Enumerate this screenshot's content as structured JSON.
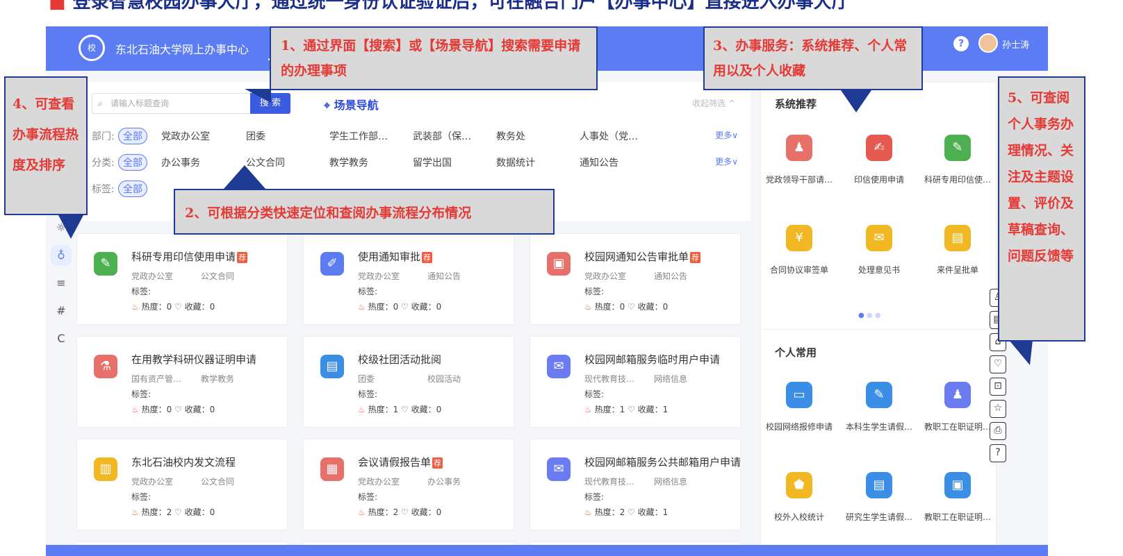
{
  "slide": {
    "title": "登录智慧校园办事大厅，通过统一身份认证验证后，可在融合门户【办事中心】直接进入办事大厅"
  },
  "header": {
    "site_name": "东北石油大学网上办事中心",
    "help": "?",
    "user": "孙士涛"
  },
  "search": {
    "placeholder": "请输入标题查询",
    "button": "搜 索",
    "scene_nav": "场景导航",
    "collapse": "收起筛选 ^"
  },
  "filters": [
    {
      "label": "部门:",
      "all": "全部",
      "items": [
        "党政办公室",
        "团委",
        "学生工作部…",
        "武装部（保…",
        "教务处",
        "人事处（党…"
      ],
      "more": "更多∨"
    },
    {
      "label": "分类:",
      "all": "全部",
      "items": [
        "办公事务",
        "公文合同",
        "教学教务",
        "留学出国",
        "数据统计",
        "通知公告"
      ],
      "more": "更多∨"
    },
    {
      "label": "标签:",
      "all": "全部",
      "items": [],
      "more": ""
    }
  ],
  "cards": [
    {
      "name": "科研专用印信使用申请",
      "badge": "荐",
      "dept": "党政办公室",
      "cat": "公文合同",
      "tag": "标签:",
      "stats": "热度：0 ♡ 收藏：0",
      "color": "#4caf50"
    },
    {
      "name": "使用通知审批",
      "badge": "荐",
      "dept": "党政办公室",
      "cat": "通知公告",
      "tag": "标签:",
      "stats": "热度：0 ♡ 收藏：0",
      "color": "#5b7cf2"
    },
    {
      "name": "校园网通知公告审批单",
      "badge": "荐",
      "dept": "党政办公室",
      "cat": "通知公告",
      "tag": "标签:",
      "stats": "热度：0 ♡ 收藏：0",
      "color": "#e8706b"
    },
    {
      "name": "在用教学科研仪器证明申请",
      "badge": "",
      "dept": "国有资产管…",
      "cat": "教学教务",
      "tag": "标签:",
      "stats": "热度：0 ♡ 收藏：0",
      "color": "#e8706b"
    },
    {
      "name": "校级社团活动批阅",
      "badge": "",
      "dept": "团委",
      "cat": "校园活动",
      "tag": "标签:",
      "stats": "热度：1 ♡ 收藏：0",
      "color": "#3a8ee6"
    },
    {
      "name": "校园网邮箱服务临时用户申请",
      "badge": "",
      "dept": "现代教育技…",
      "cat": "网络信息",
      "tag": "标签:",
      "stats": "热度：1 ♡ 收藏：1",
      "color": "#6b7cf2"
    },
    {
      "name": "东北石油校内发文流程",
      "badge": "",
      "dept": "党政办公室",
      "cat": "公文合同",
      "tag": "标签:",
      "stats": "热度：2 ♡ 收藏：0",
      "color": "#f2b824"
    },
    {
      "name": "会议请假报告单",
      "badge": "荐",
      "dept": "党政办公室",
      "cat": "办公事务",
      "tag": "标签:",
      "stats": "热度：2 ♡ 收藏：0",
      "color": "#e8706b"
    },
    {
      "name": "校园网邮箱服务公共邮箱用户申请",
      "badge": "",
      "dept": "现代教育技…",
      "cat": "网络信息",
      "tag": "标签:",
      "stats": "热度：2 ♡ 收藏：1",
      "color": "#6b7cf2"
    }
  ],
  "recommend": {
    "title": "系统推荐",
    "items": [
      {
        "name": "党政领导干部请…",
        "color": "#e8706b",
        "icon": "person-icon"
      },
      {
        "name": "印信使用申请",
        "color": "#e55a4e",
        "icon": "stamp-icon"
      },
      {
        "name": "科研专用印信使…",
        "color": "#4caf50",
        "icon": "leaf-icon"
      },
      {
        "name": "合同协议审签单",
        "color": "#f2b824",
        "icon": "money-icon"
      },
      {
        "name": "处理意见书",
        "color": "#f2b824",
        "icon": "mail-icon"
      },
      {
        "name": "来件呈批单",
        "color": "#f2b824",
        "icon": "clipboard-icon"
      }
    ]
  },
  "common": {
    "title": "个人常用",
    "items": [
      {
        "name": "校园网络报修申请",
        "color": "#3a8ee6",
        "icon": "monitor-icon"
      },
      {
        "name": "本科生学生请假…",
        "color": "#3a8ee6",
        "icon": "edit-user-icon"
      },
      {
        "name": "教职工在职证明…",
        "color": "#6b7cf2",
        "icon": "desk-icon"
      },
      {
        "name": "校外入校统计",
        "color": "#f2b824",
        "icon": "shield-icon"
      },
      {
        "name": "研究生学生请假…",
        "color": "#3a8ee6",
        "icon": "doc-search-icon"
      },
      {
        "name": "教职工在职证明…",
        "color": "#3a8ee6",
        "icon": "id-card-icon"
      }
    ]
  },
  "callouts": {
    "c1": "1、通过界面【搜索】或【场景导航】搜索需要申请的办理事项",
    "c2": "2、可根据分类快速定位和查阅办事流程分布情况",
    "c3": "3、办事服务：系统推荐、个人常用以及个人收藏",
    "c4": "4、可查看办事流程热度及排序",
    "c5": "5、可查阅个人事务办理情况、关注及主题设置、评价及草稿查询、问题反馈等"
  }
}
